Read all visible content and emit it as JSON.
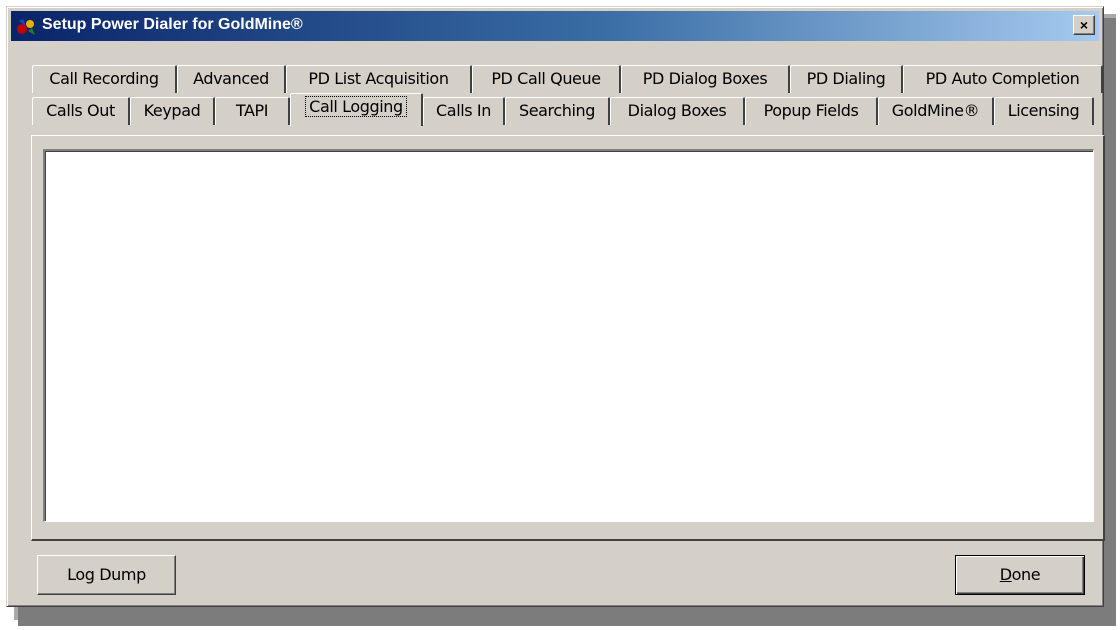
{
  "window": {
    "title": "Setup Power Dialer for GoldMine®",
    "close_label": "×"
  },
  "tabs_row1": [
    {
      "label": "Call Recording"
    },
    {
      "label": "Advanced"
    },
    {
      "label": "PD List Acquisition"
    },
    {
      "label": "PD Call Queue"
    },
    {
      "label": "PD Dialog Boxes"
    },
    {
      "label": "PD Dialing"
    },
    {
      "label": "PD Auto Completion"
    }
  ],
  "tabs_row2": [
    {
      "label": "Calls Out"
    },
    {
      "label": "Keypad"
    },
    {
      "label": "TAPI"
    },
    {
      "label": "Call Logging",
      "selected": true
    },
    {
      "label": "Calls In"
    },
    {
      "label": "Searching"
    },
    {
      "label": "Dialog Boxes"
    },
    {
      "label": "Popup Fields"
    },
    {
      "label": "GoldMine®"
    },
    {
      "label": "Licensing"
    }
  ],
  "log": {
    "content": ""
  },
  "buttons": {
    "log_dump": "Log Dump",
    "done_mnemonic": "D",
    "done_rest": "one"
  }
}
